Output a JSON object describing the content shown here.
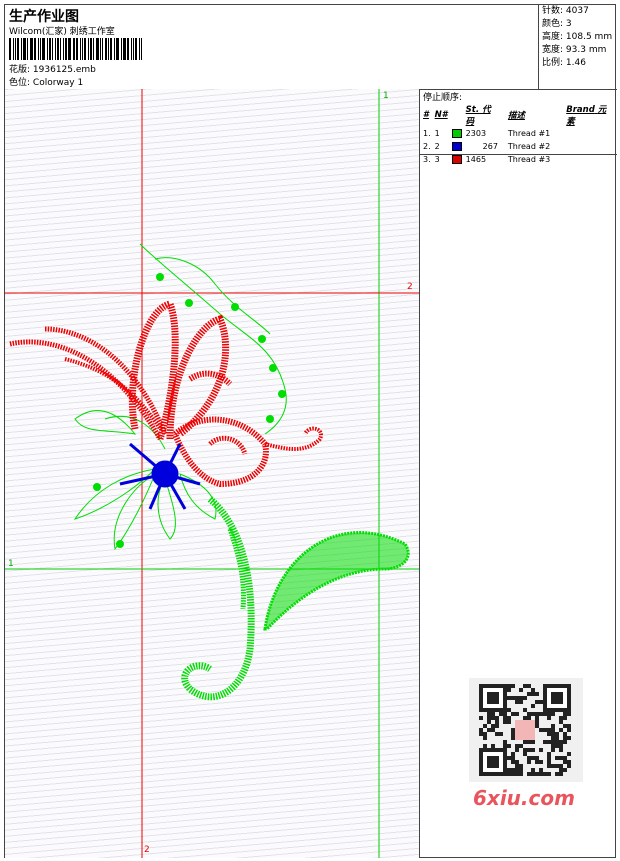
{
  "header": {
    "title": "生产作业图",
    "studio": "Wilcom(汇家) 刺绣工作室",
    "design_label": "花版:",
    "design_value": "1936125.emb",
    "colorway_label": "色位:",
    "colorway_value": "Colorway 1"
  },
  "stats": {
    "stitches_label": "针数:",
    "stitches_value": "4037",
    "colors_label": "颜色:",
    "colors_value": "3",
    "height_label": "高度:",
    "height_value": "108.5 mm",
    "width_label": "宽度:",
    "width_value": "93.3 mm",
    "scale_label": "比例:",
    "scale_value": "1.46"
  },
  "stop_sequence": {
    "title": "停止顺序:",
    "columns": [
      "#",
      "N#",
      "St.",
      "代码",
      "描述",
      "Brand",
      "元素"
    ],
    "rows": [
      {
        "index": "1.",
        "n": "1",
        "color": "#00cc00",
        "code": "2303",
        "desc": "Thread #1"
      },
      {
        "index": "2.",
        "n": "2",
        "color": "#0000cc",
        "code": "267",
        "desc": "Thread #2"
      },
      {
        "index": "3.",
        "n": "3",
        "color": "#dd0000",
        "code": "1465",
        "desc": "Thread #3"
      }
    ]
  },
  "guides": {
    "red_v": "2",
    "green_v": "1",
    "red_h": "2",
    "green_h": "1",
    "red_v_bottom": "2"
  },
  "watermark": {
    "brand": "6xiu.com"
  },
  "colors": {
    "green": "#00dd00",
    "blue": "#0000dd",
    "red": "#ee0000"
  }
}
